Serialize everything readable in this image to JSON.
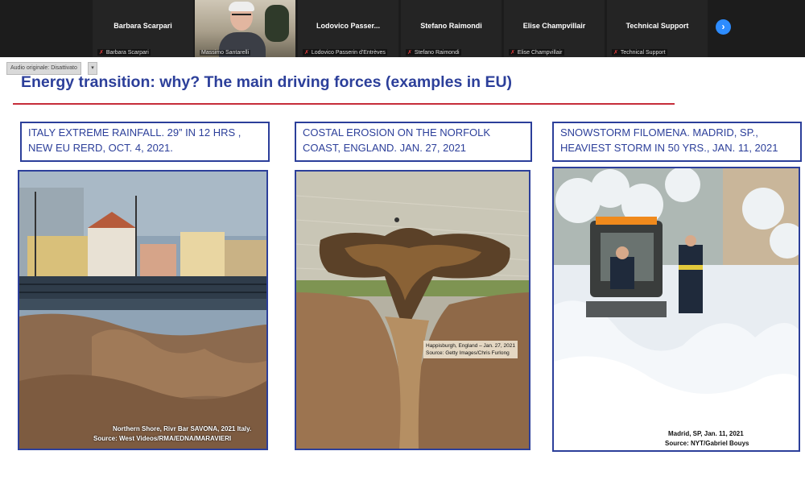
{
  "participants": [
    {
      "name": "Barbara Scarpari",
      "footer": "Barbara Scarpari",
      "video": false
    },
    {
      "name": "",
      "footer": "Massimo Santarelli",
      "video": true
    },
    {
      "name": "Lodovico Passer...",
      "footer": "Lodovico Passerin d'Entrèves",
      "video": false
    },
    {
      "name": "Stefano Raimondi",
      "footer": "Stefano Raimondi",
      "video": false
    },
    {
      "name": "Elise Champvillair",
      "footer": "Elise Champvillair",
      "video": false
    },
    {
      "name": "Technical Support",
      "footer": "Technical Support",
      "video": false
    }
  ],
  "next_icon": "chevron-right-icon",
  "audio": {
    "label": "Audio originale: Disattivato",
    "caret": "▾"
  },
  "slide": {
    "title": "Energy transition: why? The main driving forces (examples in EU)",
    "accent_color": "#2c3f9a",
    "rule_color": "#c62d3a",
    "panels": [
      {
        "caption_line1": "ITALY EXTREME RAINFALL. 29” IN 12 HRS ,",
        "caption_line2": "NEW EU RERD, OCT. 4, 2021.",
        "credit_line1": "Northern Shore, Rivr Bar SAVONA, 2021 Italy.",
        "credit_line2": "Source: West Videos/RMA/EDNA/MARAVIERI"
      },
      {
        "caption_line1": "COSTAL EROSION ON THE NORFOLK",
        "caption_line2": "COAST, ENGLAND. JAN. 27, 2021",
        "label_line1": "Happisburgh, England – Jan. 27, 2021",
        "label_line2": "Source: Getty Images/Chris Furlong"
      },
      {
        "caption_line1": "SNOWSTORM FILOMENA. MADRID, SP.,",
        "caption_line2": "HEAVIEST STORM IN 50 YRS., JAN. 11, 2021",
        "credit_line1": "Madrid, SP, Jan. 11, 2021",
        "credit_line2": "Source: NYT/Gabriel Bouys"
      }
    ]
  }
}
